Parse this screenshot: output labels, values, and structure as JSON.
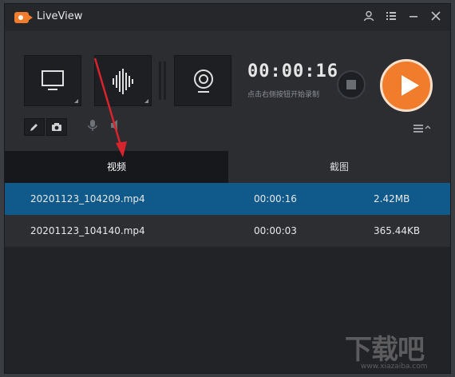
{
  "app": {
    "title": "LiveView"
  },
  "titlebar": {
    "icons": [
      "user-icon",
      "list-icon",
      "minimize-icon",
      "close-icon"
    ]
  },
  "recorder": {
    "timer": "00:00:16",
    "hint": "点击右侧按钮开始录制"
  },
  "tabs": [
    {
      "label": "视频",
      "active": true
    },
    {
      "label": "截图",
      "active": false
    }
  ],
  "recordings": [
    {
      "name": "20201123_104209.mp4",
      "duration": "00:00:16",
      "size": "2.42MB",
      "selected": true
    },
    {
      "name": "20201123_104140.mp4",
      "duration": "00:00:03",
      "size": "365.44KB",
      "selected": false
    }
  ],
  "watermark": {
    "text": "下载吧",
    "url": "www.xiazaiba.com"
  },
  "colors": {
    "accent": "#f07c2c",
    "selected_row": "#0f5a8a",
    "annotation_arrow": "#d9232d"
  }
}
